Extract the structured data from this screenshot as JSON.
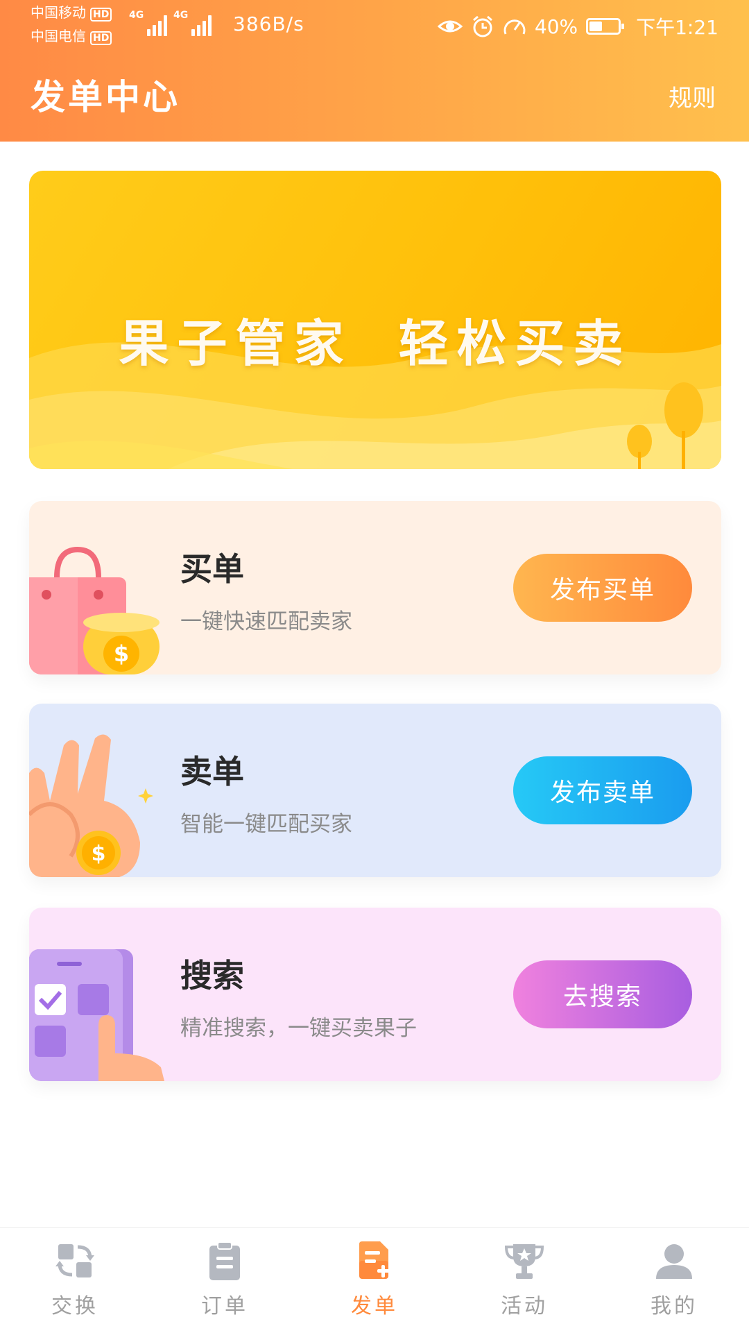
{
  "status_bar": {
    "carrier1": "中国移动",
    "carrier2": "中国电信",
    "hd": "HD",
    "network1": "4G",
    "network2": "4G",
    "net_speed": "386B/s",
    "battery": "40%",
    "time": "下午1:21"
  },
  "header": {
    "title": "发单中心",
    "rules_label": "规则"
  },
  "banner": {
    "text": "果子管家 轻松买卖"
  },
  "cards": [
    {
      "title": "买单",
      "subtitle": "一键快速匹配卖家",
      "button": "发布买单"
    },
    {
      "title": "卖单",
      "subtitle": "智能一键匹配买家",
      "button": "发布卖单"
    },
    {
      "title": "搜索",
      "subtitle": "精准搜索，一键买卖果子",
      "button": "去搜索"
    }
  ],
  "nav": [
    {
      "label": "交换",
      "icon": "exchange-icon"
    },
    {
      "label": "订单",
      "icon": "clipboard-icon"
    },
    {
      "label": "发单",
      "icon": "post-order-icon",
      "active": true
    },
    {
      "label": "活动",
      "icon": "trophy-icon"
    },
    {
      "label": "我的",
      "icon": "user-icon"
    }
  ],
  "colors": {
    "accent": "#ff8a3c",
    "nav_inactive": "#a0a0a0"
  }
}
